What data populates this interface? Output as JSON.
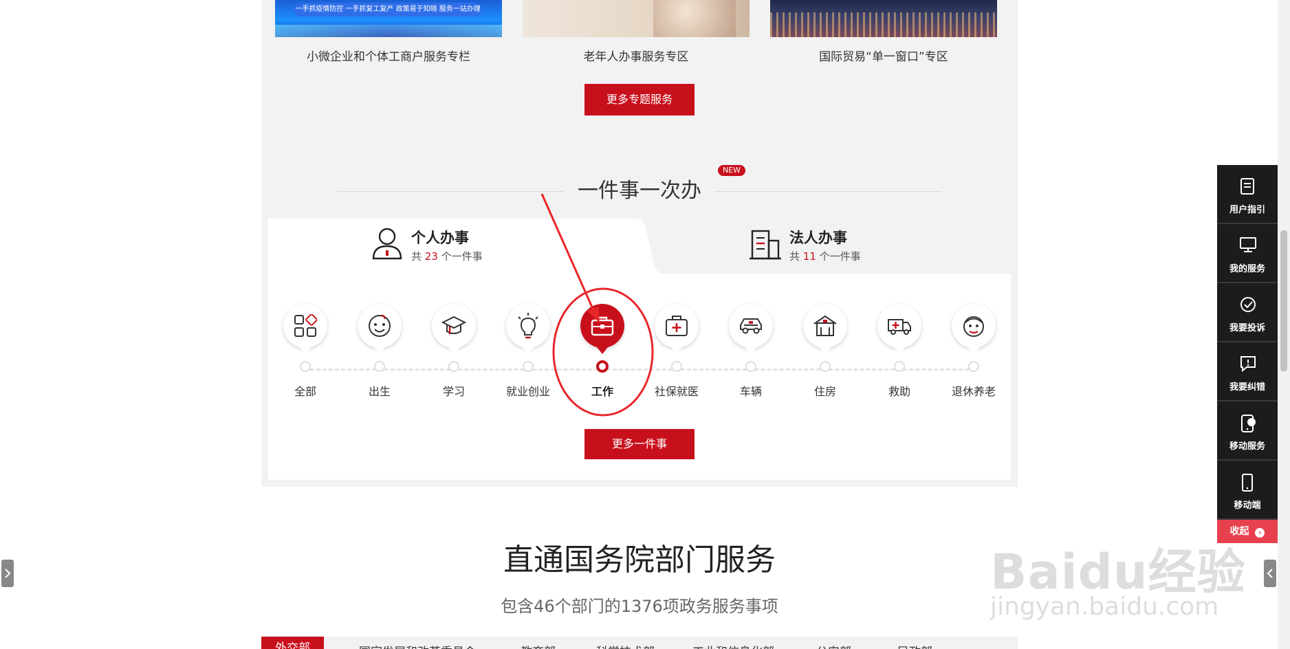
{
  "banners": {
    "items": [
      {
        "caption": "小微企业和个体工商户服务专栏",
        "strip_text": "一手抓疫情防控 一手抓复工复产 政策易于知晓 服务一站办理"
      },
      {
        "caption": "老年人办事服务专区"
      },
      {
        "caption": "国际贸易“单一窗口”专区"
      }
    ],
    "more_label": "更多专题服务"
  },
  "section": {
    "title": "一件事一次办",
    "badge": "NEW"
  },
  "tabs": {
    "personal": {
      "title": "个人办事",
      "prefix": "共",
      "count": "23",
      "suffix": "个一件事"
    },
    "corporate": {
      "title": "法人办事",
      "prefix": "共",
      "count": "11",
      "suffix": "个一件事"
    }
  },
  "timeline": {
    "items": [
      {
        "label": "全部",
        "icon": "grid-icon"
      },
      {
        "label": "出生",
        "icon": "baby-icon"
      },
      {
        "label": "学习",
        "icon": "graduation-cap-icon"
      },
      {
        "label": "就业创业",
        "icon": "lightbulb-icon"
      },
      {
        "label": "工作",
        "icon": "briefcase-icon",
        "active": true
      },
      {
        "label": "社保就医",
        "icon": "medical-kit-icon"
      },
      {
        "label": "车辆",
        "icon": "car-icon"
      },
      {
        "label": "住房",
        "icon": "house-icon"
      },
      {
        "label": "救助",
        "icon": "ambulance-icon"
      },
      {
        "label": "退休养老",
        "icon": "elderly-icon"
      }
    ],
    "more_label": "更多一件事"
  },
  "departments": {
    "title": "直通国务院部门服务",
    "subtitle": "包含46个部门的1376项政务服务事项",
    "tabs": [
      "外交部",
      "国家发展和改革委员会",
      "教育部",
      "科学技术部",
      "工业和信息化部",
      "公安部",
      "民政部"
    ]
  },
  "sidebar": {
    "items": [
      {
        "label": "用户指引",
        "icon": "document-icon"
      },
      {
        "label": "我的服务",
        "icon": "monitor-icon"
      },
      {
        "label": "我要投诉",
        "icon": "complaint-icon"
      },
      {
        "label": "我要纠错",
        "icon": "error-report-icon"
      },
      {
        "label": "移动服务",
        "icon": "mobile-cloud-icon"
      },
      {
        "label": "移动端",
        "icon": "phone-icon"
      }
    ],
    "collapse_label": "收起"
  },
  "watermark": {
    "brand": "Baidu经验",
    "url": "jingyan.baidu.com"
  },
  "colors": {
    "accent": "#c8101c",
    "sidebar_bg": "#1c1c1c",
    "collapse": "#e8414e",
    "section_bg": "#f2f2f2"
  }
}
